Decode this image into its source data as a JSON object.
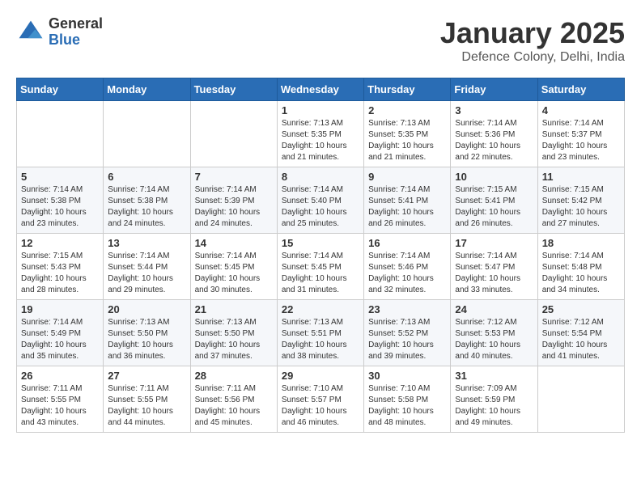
{
  "logo": {
    "general": "General",
    "blue": "Blue"
  },
  "title": "January 2025",
  "location": "Defence Colony, Delhi, India",
  "days_of_week": [
    "Sunday",
    "Monday",
    "Tuesday",
    "Wednesday",
    "Thursday",
    "Friday",
    "Saturday"
  ],
  "weeks": [
    [
      {
        "day": "",
        "info": ""
      },
      {
        "day": "",
        "info": ""
      },
      {
        "day": "",
        "info": ""
      },
      {
        "day": "1",
        "info": "Sunrise: 7:13 AM\nSunset: 5:35 PM\nDaylight: 10 hours\nand 21 minutes."
      },
      {
        "day": "2",
        "info": "Sunrise: 7:13 AM\nSunset: 5:35 PM\nDaylight: 10 hours\nand 21 minutes."
      },
      {
        "day": "3",
        "info": "Sunrise: 7:14 AM\nSunset: 5:36 PM\nDaylight: 10 hours\nand 22 minutes."
      },
      {
        "day": "4",
        "info": "Sunrise: 7:14 AM\nSunset: 5:37 PM\nDaylight: 10 hours\nand 23 minutes."
      }
    ],
    [
      {
        "day": "5",
        "info": "Sunrise: 7:14 AM\nSunset: 5:38 PM\nDaylight: 10 hours\nand 23 minutes."
      },
      {
        "day": "6",
        "info": "Sunrise: 7:14 AM\nSunset: 5:38 PM\nDaylight: 10 hours\nand 24 minutes."
      },
      {
        "day": "7",
        "info": "Sunrise: 7:14 AM\nSunset: 5:39 PM\nDaylight: 10 hours\nand 24 minutes."
      },
      {
        "day": "8",
        "info": "Sunrise: 7:14 AM\nSunset: 5:40 PM\nDaylight: 10 hours\nand 25 minutes."
      },
      {
        "day": "9",
        "info": "Sunrise: 7:14 AM\nSunset: 5:41 PM\nDaylight: 10 hours\nand 26 minutes."
      },
      {
        "day": "10",
        "info": "Sunrise: 7:15 AM\nSunset: 5:41 PM\nDaylight: 10 hours\nand 26 minutes."
      },
      {
        "day": "11",
        "info": "Sunrise: 7:15 AM\nSunset: 5:42 PM\nDaylight: 10 hours\nand 27 minutes."
      }
    ],
    [
      {
        "day": "12",
        "info": "Sunrise: 7:15 AM\nSunset: 5:43 PM\nDaylight: 10 hours\nand 28 minutes."
      },
      {
        "day": "13",
        "info": "Sunrise: 7:14 AM\nSunset: 5:44 PM\nDaylight: 10 hours\nand 29 minutes."
      },
      {
        "day": "14",
        "info": "Sunrise: 7:14 AM\nSunset: 5:45 PM\nDaylight: 10 hours\nand 30 minutes."
      },
      {
        "day": "15",
        "info": "Sunrise: 7:14 AM\nSunset: 5:45 PM\nDaylight: 10 hours\nand 31 minutes."
      },
      {
        "day": "16",
        "info": "Sunrise: 7:14 AM\nSunset: 5:46 PM\nDaylight: 10 hours\nand 32 minutes."
      },
      {
        "day": "17",
        "info": "Sunrise: 7:14 AM\nSunset: 5:47 PM\nDaylight: 10 hours\nand 33 minutes."
      },
      {
        "day": "18",
        "info": "Sunrise: 7:14 AM\nSunset: 5:48 PM\nDaylight: 10 hours\nand 34 minutes."
      }
    ],
    [
      {
        "day": "19",
        "info": "Sunrise: 7:14 AM\nSunset: 5:49 PM\nDaylight: 10 hours\nand 35 minutes."
      },
      {
        "day": "20",
        "info": "Sunrise: 7:13 AM\nSunset: 5:50 PM\nDaylight: 10 hours\nand 36 minutes."
      },
      {
        "day": "21",
        "info": "Sunrise: 7:13 AM\nSunset: 5:50 PM\nDaylight: 10 hours\nand 37 minutes."
      },
      {
        "day": "22",
        "info": "Sunrise: 7:13 AM\nSunset: 5:51 PM\nDaylight: 10 hours\nand 38 minutes."
      },
      {
        "day": "23",
        "info": "Sunrise: 7:13 AM\nSunset: 5:52 PM\nDaylight: 10 hours\nand 39 minutes."
      },
      {
        "day": "24",
        "info": "Sunrise: 7:12 AM\nSunset: 5:53 PM\nDaylight: 10 hours\nand 40 minutes."
      },
      {
        "day": "25",
        "info": "Sunrise: 7:12 AM\nSunset: 5:54 PM\nDaylight: 10 hours\nand 41 minutes."
      }
    ],
    [
      {
        "day": "26",
        "info": "Sunrise: 7:11 AM\nSunset: 5:55 PM\nDaylight: 10 hours\nand 43 minutes."
      },
      {
        "day": "27",
        "info": "Sunrise: 7:11 AM\nSunset: 5:55 PM\nDaylight: 10 hours\nand 44 minutes."
      },
      {
        "day": "28",
        "info": "Sunrise: 7:11 AM\nSunset: 5:56 PM\nDaylight: 10 hours\nand 45 minutes."
      },
      {
        "day": "29",
        "info": "Sunrise: 7:10 AM\nSunset: 5:57 PM\nDaylight: 10 hours\nand 46 minutes."
      },
      {
        "day": "30",
        "info": "Sunrise: 7:10 AM\nSunset: 5:58 PM\nDaylight: 10 hours\nand 48 minutes."
      },
      {
        "day": "31",
        "info": "Sunrise: 7:09 AM\nSunset: 5:59 PM\nDaylight: 10 hours\nand 49 minutes."
      },
      {
        "day": "",
        "info": ""
      }
    ]
  ]
}
